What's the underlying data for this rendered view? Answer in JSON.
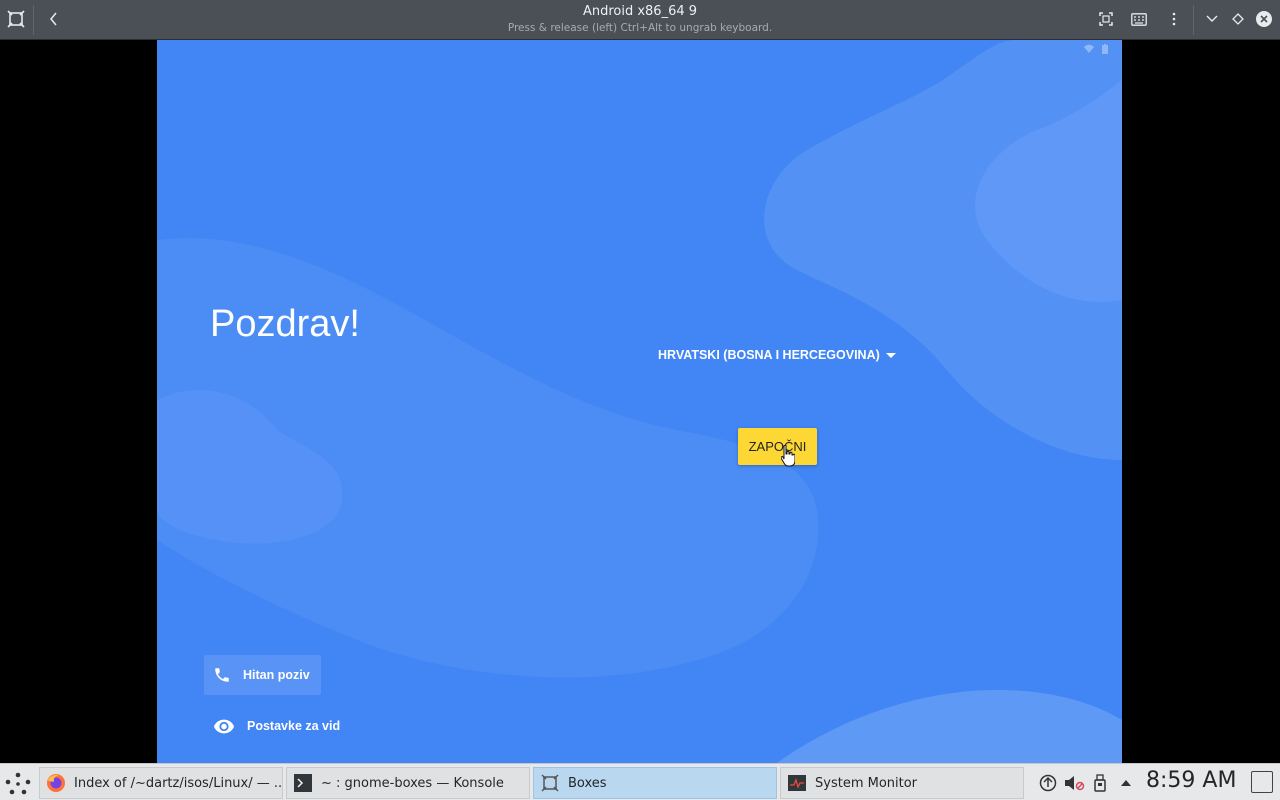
{
  "window": {
    "title": "Android x86_64 9",
    "subtitle": "Press & release (left) Ctrl+Alt to ungrab keyboard."
  },
  "icons": {
    "app": "boxes-icon",
    "back": "back-chevron-icon",
    "fullscreen": "fullscreen-icon",
    "keyboard": "keyboard-icon",
    "menu": "kebab-menu-icon",
    "minimize": "minimize-chevron-icon",
    "maximize": "maximize-diamond-icon",
    "close": "close-icon"
  },
  "android": {
    "greeting": "Pozdrav!",
    "language": "HRVATSKI (BOSNA I HERCEGOVINA)",
    "start_button": "ZAPOČNI",
    "emergency_call": "Hitan poziv",
    "vision_settings": "Postavke za vid",
    "colors": {
      "background": "#4285f4",
      "button": "#fdd835"
    }
  },
  "taskbar": {
    "tasks": [
      {
        "label": "Index of /~dartz/isos/Linux/ — ...",
        "icon": "firefox-icon",
        "active": false
      },
      {
        "label": "~ : gnome-boxes — Konsole",
        "icon": "konsole-icon",
        "active": false
      },
      {
        "label": "Boxes",
        "icon": "boxes-icon",
        "active": true
      },
      {
        "label": "System Monitor",
        "icon": "system-monitor-icon",
        "active": false
      }
    ],
    "clock": "8:59 AM"
  }
}
